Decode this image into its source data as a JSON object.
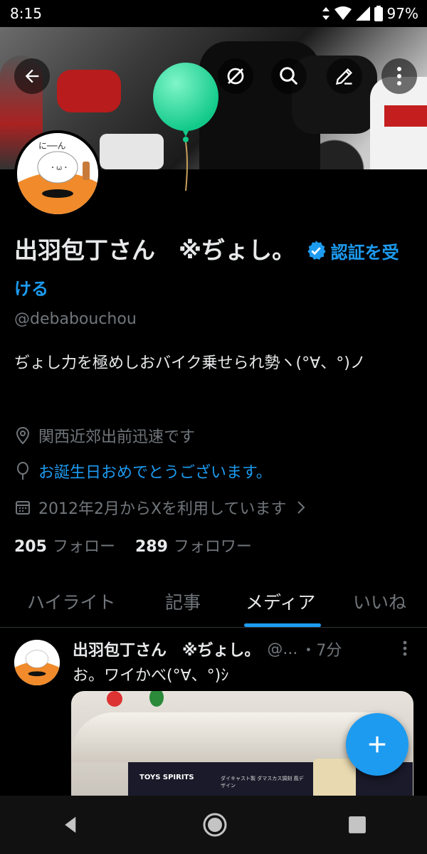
{
  "status_bar": {
    "time": "8:15",
    "battery": "97%"
  },
  "profile": {
    "display_name": "出羽包丁さん　※ぢょし。",
    "verify_cta": "認証を受ける",
    "handle": "@debabouchou",
    "bio": "ぢょし力を極めしおバイク乗せられ勢ヽ(°∀、°)ノ",
    "location": "関西近郊出前迅速です",
    "birthday": "お誕生日おめでとうございます。",
    "joined": "2012年2月からXを利用しています",
    "following_count": "205",
    "following_label": "フォロー",
    "followers_count": "289",
    "followers_label": "フォロワー"
  },
  "avatar_text": "に──ん",
  "tabs": [
    {
      "label": "ハイライト"
    },
    {
      "label": "記事"
    },
    {
      "label": "メディア",
      "active": true
    },
    {
      "label": "いいね"
    }
  ],
  "tweet": {
    "name": "出羽包丁さん　※ぢょし。",
    "handle": "@...",
    "time": "・7分",
    "text": "お。ワイかべ(°∀、°)ｼ",
    "media_caption": "ダイキャスト製 ダマスカス調刻 風デザイン",
    "media_brand": "TOYS SPIRITS"
  },
  "colors": {
    "accent": "#1d9bf0",
    "background": "#000000",
    "muted": "#71767b",
    "balloon": "#2ee6a0"
  },
  "icons": [
    "back-arrow-icon",
    "visibility-icon",
    "search-icon",
    "edit-icon",
    "more-vert-icon",
    "verified-badge-icon",
    "location-icon",
    "balloon-icon",
    "calendar-icon",
    "chevron-right-icon",
    "plus-icon",
    "nav-back-icon",
    "nav-home-icon",
    "nav-recents-icon"
  ]
}
